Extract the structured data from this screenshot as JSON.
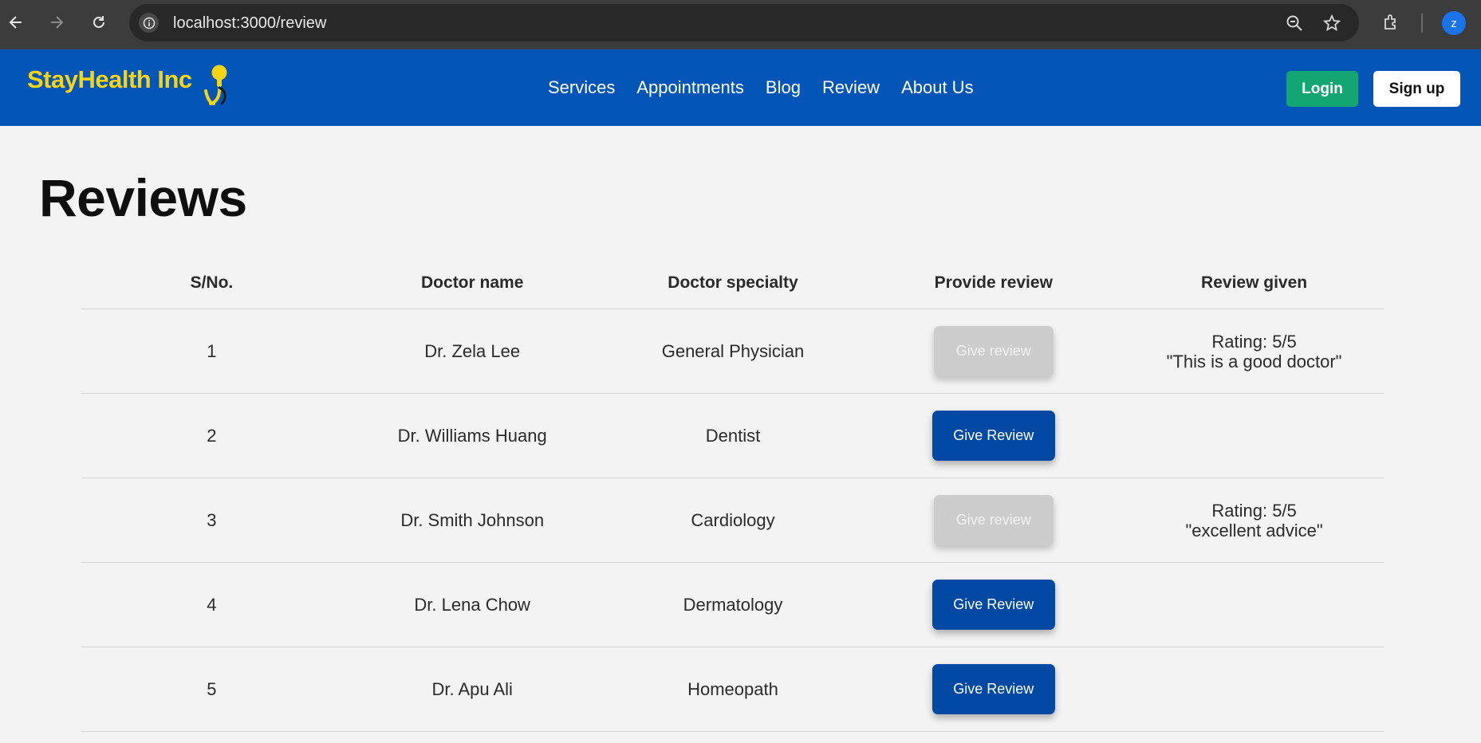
{
  "browser": {
    "url": "localhost:3000/review",
    "profile_initial": "z",
    "icons": [
      "back-icon",
      "forward-icon",
      "reload-icon",
      "site-info-icon",
      "zoom-icon",
      "bookmark-star-icon",
      "extensions-icon"
    ]
  },
  "header": {
    "brand": "StayHealth Inc",
    "nav": [
      "Services",
      "Appointments",
      "Blog",
      "Review",
      "About Us"
    ],
    "login": "Login",
    "signup": "Sign up",
    "colors": {
      "bar": "#0355b8",
      "brand": "#f6d414",
      "login": "#13a672"
    }
  },
  "main": {
    "title": "Reviews",
    "columns": [
      "S/No.",
      "Doctor name",
      "Doctor specialty",
      "Provide review",
      "Review given"
    ],
    "rows": [
      {
        "sno": "1",
        "name": "Dr. Zela Lee",
        "specialty": "General Physician",
        "action": "Give review",
        "action_enabled": false,
        "rating": "Rating: 5/5",
        "comment": "\"This is a good doctor\""
      },
      {
        "sno": "2",
        "name": "Dr. Williams Huang",
        "specialty": "Dentist",
        "action": "Give Review",
        "action_enabled": true,
        "rating": "",
        "comment": ""
      },
      {
        "sno": "3",
        "name": "Dr. Smith Johnson",
        "specialty": "Cardiology",
        "action": "Give review",
        "action_enabled": false,
        "rating": "Rating: 5/5",
        "comment": "\"excellent advice\""
      },
      {
        "sno": "4",
        "name": "Dr. Lena Chow",
        "specialty": "Dermatology",
        "action": "Give Review",
        "action_enabled": true,
        "rating": "",
        "comment": ""
      },
      {
        "sno": "5",
        "name": "Dr. Apu Ali",
        "specialty": "Homeopath",
        "action": "Give Review",
        "action_enabled": true,
        "rating": "",
        "comment": ""
      }
    ]
  }
}
